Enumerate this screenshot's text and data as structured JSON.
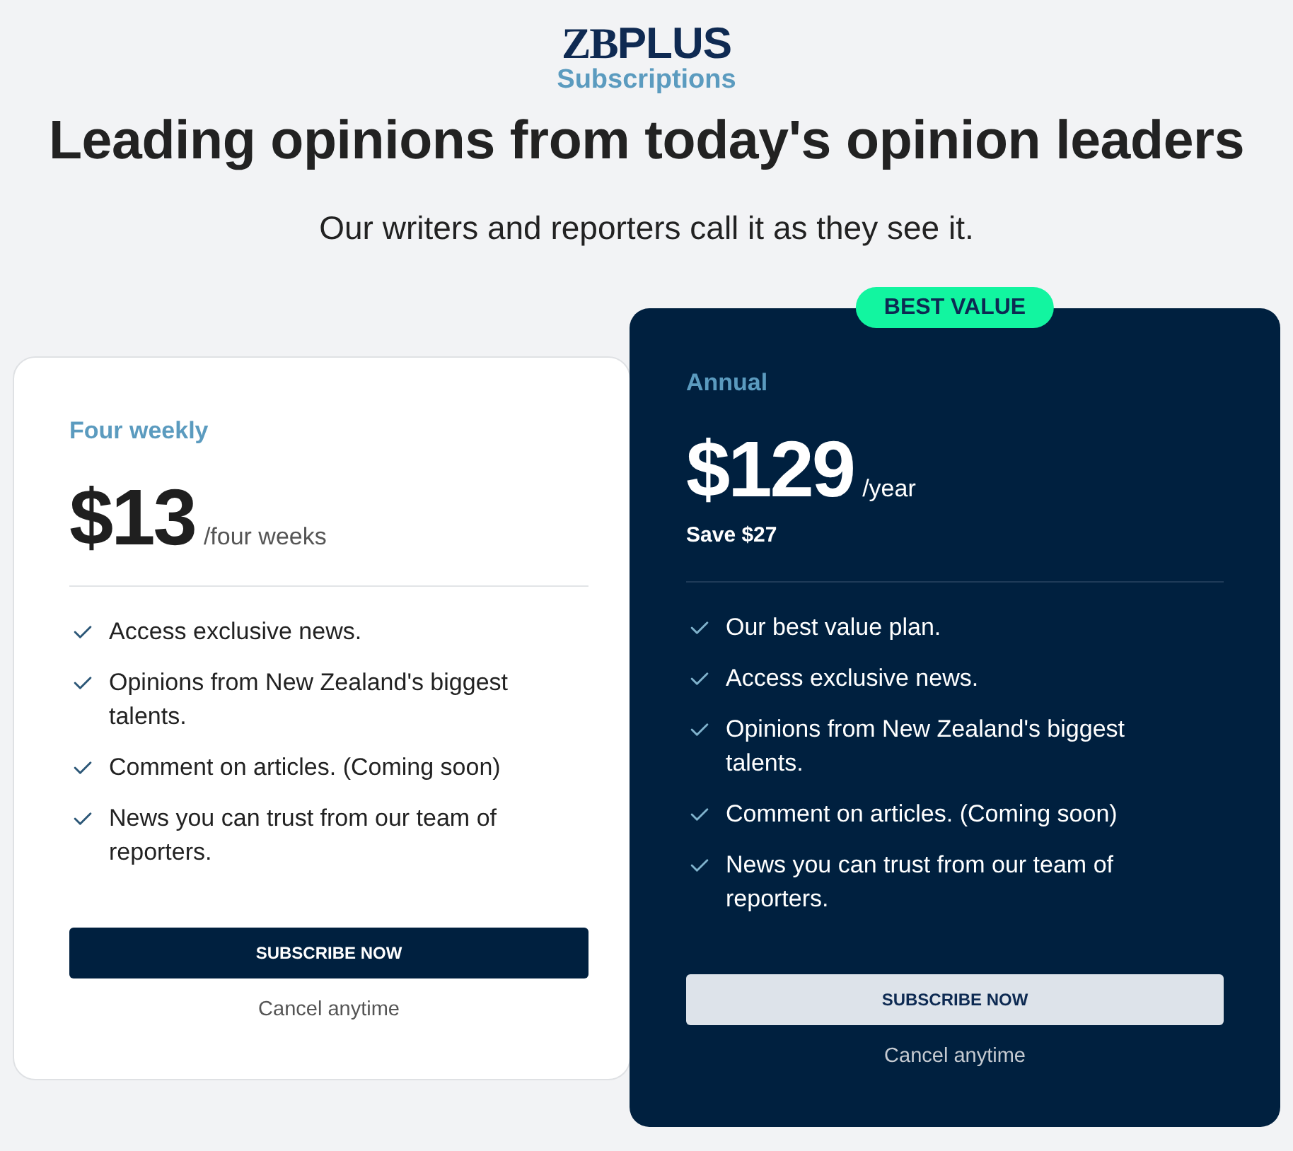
{
  "logo": {
    "mark_serif": "ZB",
    "mark_sans": "PLUS",
    "subtitle": "Subscriptions"
  },
  "headline": "Leading opinions from today's opinion leaders",
  "subheadline": "Our writers and reporters call it as they see it.",
  "plans": [
    {
      "featured": false,
      "name": "Four weekly",
      "price": "$13",
      "period": "/four weeks",
      "features": [
        "Access exclusive news.",
        "Opinions from New Zealand's biggest talents.",
        "Comment on articles. (Coming soon)",
        "News you can trust from our team of reporters."
      ],
      "button": "SUBSCRIBE NOW",
      "note": "Cancel anytime"
    },
    {
      "featured": true,
      "badge": "BEST VALUE",
      "name": "Annual",
      "price": "$129",
      "period": "/year",
      "saving": "Save $27",
      "features": [
        "Our best value plan.",
        "Access exclusive news.",
        "Opinions from New Zealand's biggest talents.",
        "Comment on articles. (Coming soon)",
        "News you can trust from our team of reporters."
      ],
      "button": "SUBSCRIBE NOW",
      "note": "Cancel anytime"
    }
  ]
}
